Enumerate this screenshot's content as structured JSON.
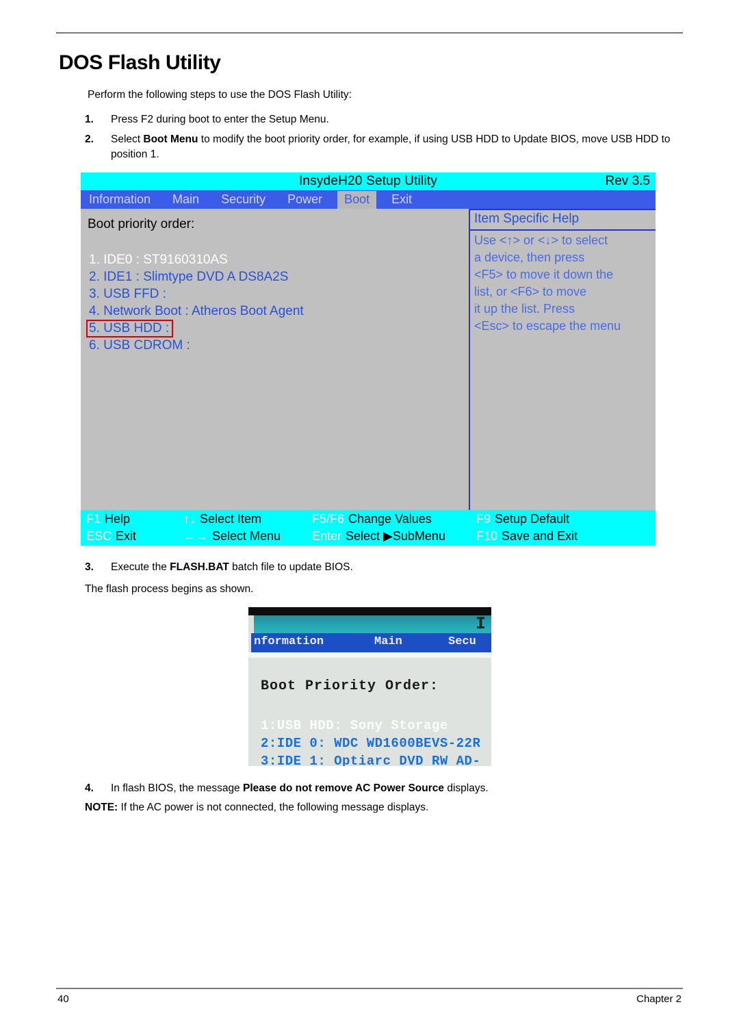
{
  "document": {
    "title": "DOS Flash Utility",
    "intro": "Perform the following steps to use the DOS Flash Utility:",
    "steps": [
      {
        "number": "1.",
        "text_before": "Press F2 during boot to enter the Setup Menu.",
        "bold": "",
        "text_after": ""
      },
      {
        "number": "2.",
        "text_before": "Select ",
        "bold": "Boot Menu",
        "text_after": " to modify the boot priority order, for example, if using USB HDD to Update BIOS, move USB HDD to position 1."
      },
      {
        "number": "3.",
        "text_before": "Execute the ",
        "bold": "FLASH.BAT",
        "text_after": " batch file to update BIOS."
      },
      {
        "number": "4.",
        "text_before": "In flash BIOS, the message ",
        "bold": "Please do not remove AC Power Source",
        "text_after": " displays."
      }
    ],
    "flash_line": "The flash process begins as shown.",
    "note_label": "NOTE:",
    "note_text": " If the AC power is not connected, the following message displays.",
    "footer": {
      "page_number": "40",
      "chapter": "Chapter 2"
    }
  },
  "bios": {
    "title": "InsydeH20 Setup Utility",
    "revision": "Rev 3.5",
    "menu": [
      {
        "label": "Information",
        "active": false
      },
      {
        "label": "Main",
        "active": false
      },
      {
        "label": "Security",
        "active": false
      },
      {
        "label": "Power",
        "active": false
      },
      {
        "label": "Boot",
        "active": true
      },
      {
        "label": "Exit",
        "active": false
      }
    ],
    "section_heading": "Boot priority order:",
    "boot_items": [
      {
        "label": "1. IDE0 : ST9160310AS",
        "selected": true,
        "marked": false
      },
      {
        "label": "2. IDE1 : Slimtype DVD A DS8A2S",
        "selected": false,
        "marked": false
      },
      {
        "label": "3. USB FFD :",
        "selected": false,
        "marked": false
      },
      {
        "label": "4. Network Boot : Atheros Boot Agent",
        "selected": false,
        "marked": false
      },
      {
        "label": "5. USB HDD :",
        "selected": false,
        "marked": true
      },
      {
        "label": "6. USB CDROM :",
        "selected": false,
        "marked": false
      }
    ],
    "help": {
      "title": "Item Specific Help",
      "lines": [
        "Use <↑> or <↓> to select",
        "a device, then press",
        "<F5> to move it down the",
        "list, or <F6> to move",
        "it up the list. Press",
        "<Esc> to escape the menu"
      ]
    },
    "keybar": [
      {
        "key": "F1",
        "desc": "Help"
      },
      {
        "key": "↑↓",
        "desc": "Select Item"
      },
      {
        "key": "F5/F6",
        "desc": "Change Values"
      },
      {
        "key": "F9",
        "desc": "Setup Default"
      },
      {
        "key": "ESC",
        "desc": "Exit"
      },
      {
        "key": "←→",
        "desc": "Select Menu"
      },
      {
        "key": "Enter",
        "desc": "Select ▶SubMenu"
      },
      {
        "key": "F10",
        "desc": "Save and Exit"
      }
    ],
    "colors": {
      "title_bar": "#00ffff",
      "menu_bar": "#3b5ce8",
      "body": "#c0c0c0",
      "text_blue": "#2b4fdd",
      "marker_red": "#e00000"
    }
  },
  "flash_photo": {
    "corner_letter": "I",
    "menu": [
      "nformation",
      "Main",
      "Secu"
    ],
    "heading": "Boot Priority Order:",
    "rows": [
      {
        "label": "1:USB HDD: Sony     Storage",
        "highlighted": true
      },
      {
        "label": "2:IDE 0: WDC WD1600BEVS-22R",
        "highlighted": false
      },
      {
        "label": "3:IDE 1: Optiarc DVD RW AD-",
        "highlighted": false
      }
    ]
  }
}
